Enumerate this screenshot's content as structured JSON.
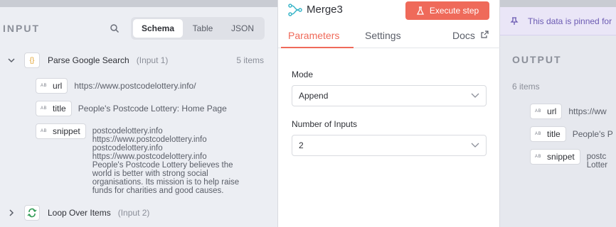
{
  "input_panel": {
    "title": "INPUT",
    "tabs": [
      "Schema",
      "Table",
      "JSON"
    ],
    "nodes": [
      {
        "name": "Parse Google Search",
        "sub": "(Input 1)",
        "count": "5 items",
        "fields": [
          {
            "key": "url",
            "value": "https://www.postcodelottery.info/"
          },
          {
            "key": "title",
            "value": "People's Postcode Lottery: Home Page"
          },
          {
            "key": "snippet",
            "value": "postcodelottery.info\nhttps://www.postcodelottery.info\npostcodelottery.info\nhttps://www.postcodelottery.info\nPeople's Postcode Lottery believes the\nworld is better with strong social\norganisations. Its mission is to help raise\nfunds for charities and good causes."
          }
        ]
      },
      {
        "name": "Loop Over Items",
        "sub": "(Input 2)"
      }
    ]
  },
  "node": {
    "title": "Merge3",
    "execute_label": "Execute step",
    "tabs": [
      "Parameters",
      "Settings",
      "Docs"
    ],
    "mode_label": "Mode",
    "mode_value": "Append",
    "inputs_label": "Number of Inputs",
    "inputs_value": "2"
  },
  "output_panel": {
    "banner": "This data is pinned for",
    "title": "OUTPUT",
    "count": "6 items",
    "fields": [
      {
        "key": "url",
        "value": "https://ww"
      },
      {
        "key": "title",
        "value": "People's P"
      },
      {
        "key": "snippet",
        "value": "postc\nLotter"
      }
    ]
  },
  "colors": {
    "accent": "#ef6a5a",
    "pin": "#6c5bb3",
    "merge_icon": "#3bb6c9",
    "loop_icon": "#2e9a53",
    "json_icon": "#e0a02b"
  },
  "icons": [
    "search-icon",
    "chevron-down-icon",
    "chevron-right-icon",
    "braces-icon",
    "loop-icon",
    "merge-icon",
    "flask-icon",
    "external-link-icon",
    "pin-icon",
    "ab-type-icon"
  ]
}
